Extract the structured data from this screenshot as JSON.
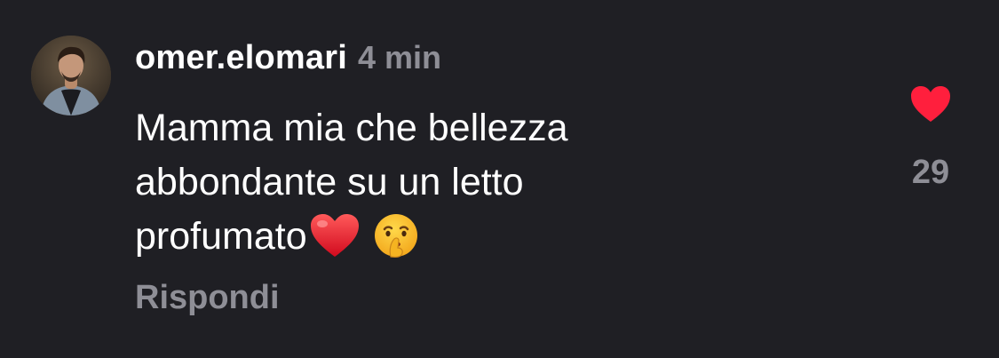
{
  "comment": {
    "username": "omer.elomari",
    "timestamp": "4 min",
    "text_lines": [
      "Mamma mia che bellezza",
      "abbondante su un letto",
      "profumato"
    ],
    "emojis": [
      "red-heart-emoji",
      "shushing-face-emoji"
    ],
    "reply_label": "Rispondi",
    "likes": {
      "count": "29",
      "liked": true,
      "heart_color": "#ff1f3d"
    }
  },
  "colors": {
    "background": "#1f1f24",
    "primary_text": "#ffffff",
    "secondary_text": "#8e8e96"
  }
}
